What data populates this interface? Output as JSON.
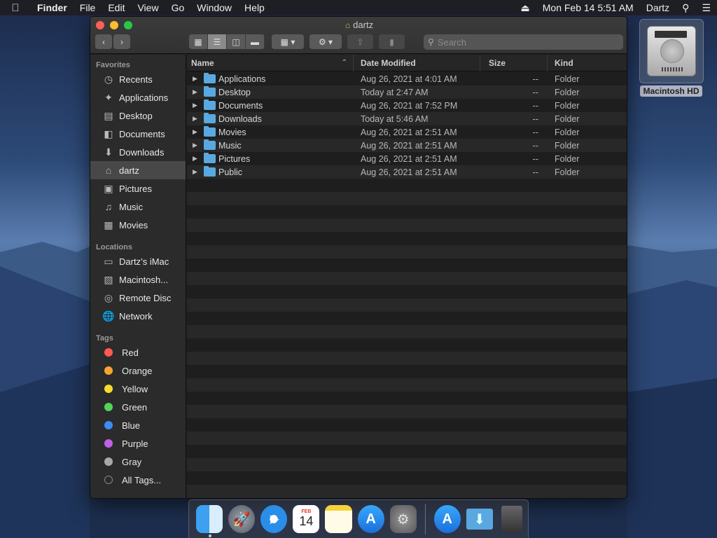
{
  "menubar": {
    "apple_icon": "apple-icon",
    "app_name": "Finder",
    "menus": [
      "File",
      "Edit",
      "View",
      "Go",
      "Window",
      "Help"
    ],
    "datetime": "Mon Feb 14  5:51 AM",
    "user": "Dartz"
  },
  "desktop": {
    "hd_label": "Macintosh HD"
  },
  "window": {
    "title": "dartz",
    "search_placeholder": "Search"
  },
  "sidebar": {
    "favorites_heading": "Favorites",
    "favorites": [
      {
        "label": "Recents",
        "icon": "clock-icon"
      },
      {
        "label": "Applications",
        "icon": "applications-icon"
      },
      {
        "label": "Desktop",
        "icon": "desktop-icon"
      },
      {
        "label": "Documents",
        "icon": "documents-icon"
      },
      {
        "label": "Downloads",
        "icon": "downloads-icon"
      },
      {
        "label": "dartz",
        "icon": "home-icon"
      },
      {
        "label": "Pictures",
        "icon": "camera-icon"
      },
      {
        "label": "Music",
        "icon": "music-icon"
      },
      {
        "label": "Movies",
        "icon": "film-icon"
      }
    ],
    "locations_heading": "Locations",
    "locations": [
      {
        "label": "Dartz’s iMac",
        "icon": "imac-icon"
      },
      {
        "label": "Macintosh...",
        "icon": "harddrive-icon"
      },
      {
        "label": "Remote Disc",
        "icon": "disc-icon"
      },
      {
        "label": "Network",
        "icon": "network-icon"
      }
    ],
    "tags_heading": "Tags",
    "tags": [
      {
        "label": "Red",
        "color": "#ff5a52"
      },
      {
        "label": "Orange",
        "color": "#f7a530"
      },
      {
        "label": "Yellow",
        "color": "#f5dc2a"
      },
      {
        "label": "Green",
        "color": "#52d45a"
      },
      {
        "label": "Blue",
        "color": "#3d8cf5"
      },
      {
        "label": "Purple",
        "color": "#c061e8"
      },
      {
        "label": "Gray",
        "color": "#a8a8ab"
      },
      {
        "label": "All Tags...",
        "color": ""
      }
    ]
  },
  "filelist": {
    "columns": {
      "name": "Name",
      "date": "Date Modified",
      "size": "Size",
      "kind": "Kind"
    },
    "rows": [
      {
        "name": "Applications",
        "date": "Aug 26, 2021 at 4:01 AM",
        "size": "--",
        "kind": "Folder"
      },
      {
        "name": "Desktop",
        "date": "Today at 2:47 AM",
        "size": "--",
        "kind": "Folder"
      },
      {
        "name": "Documents",
        "date": "Aug 26, 2021 at 7:52 PM",
        "size": "--",
        "kind": "Folder"
      },
      {
        "name": "Downloads",
        "date": "Today at 5:46 AM",
        "size": "--",
        "kind": "Folder"
      },
      {
        "name": "Movies",
        "date": "Aug 26, 2021 at 2:51 AM",
        "size": "--",
        "kind": "Folder"
      },
      {
        "name": "Music",
        "date": "Aug 26, 2021 at 2:51 AM",
        "size": "--",
        "kind": "Folder"
      },
      {
        "name": "Pictures",
        "date": "Aug 26, 2021 at 2:51 AM",
        "size": "--",
        "kind": "Folder"
      },
      {
        "name": "Public",
        "date": "Aug 26, 2021 at 2:51 AM",
        "size": "--",
        "kind": "Folder"
      }
    ]
  },
  "dock": {
    "calendar_month": "FEB",
    "calendar_day": "14"
  }
}
